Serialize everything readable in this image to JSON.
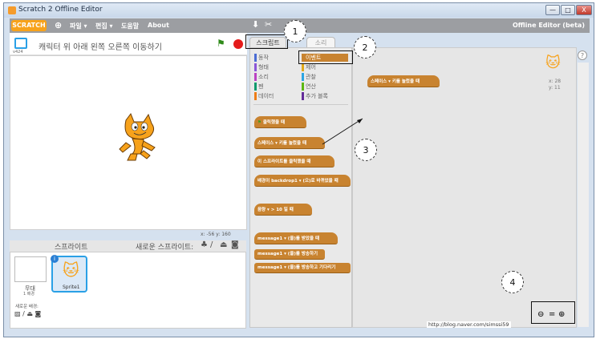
{
  "window": {
    "title": "Scratch 2 Offline Editor",
    "min": "—",
    "max": "□",
    "close": "X"
  },
  "menubar": {
    "logo": "SCRATCH",
    "items": [
      "파일 ▾",
      "편집 ▾",
      "도움말",
      "About"
    ],
    "editor_title": "Offline Editor (beta)"
  },
  "stage": {
    "project_title": "캐릭터 위 아래 왼쪽 오른쪽 이동하기",
    "version": "v424",
    "coords": "x: -56  y: 160"
  },
  "tabs": {
    "scripts": "스크립트",
    "sounds": "소리"
  },
  "palette": {
    "categories_left": [
      "동작",
      "형태",
      "소리",
      "펜",
      "데이터"
    ],
    "categories_right": [
      "이벤트",
      "제어",
      "관찰",
      "연산",
      "추가 블록"
    ],
    "blocks": {
      "when_flag": "클릭했을 때",
      "when_key": "스페이스 ▾  키를 눌렀을 때",
      "when_sprite_clicked": "이 스프라이트를 클릭했을 때",
      "when_backdrop": "배경이 backdrop1 ▾ (으)로 바뀌었을 때",
      "when_loudness": "음량 ▾ >  10  일 때",
      "when_receive": "message1 ▾ (을)를 받았을 때",
      "broadcast": "message1 ▾ (을)를 방송하기",
      "broadcast_wait": "message1 ▾ (을)를 방송하고 기다리기"
    }
  },
  "scripts": {
    "placed_block": "스페이스 ▾  키를 눌렀을 때",
    "sprite_x": "x: 28",
    "sprite_y": "y: 11",
    "watermark": "http://blog.naver.com/simssi59"
  },
  "sprites": {
    "header_label": "스프라이트",
    "new_sprite_label": "새로운 스프라이트:",
    "stage_label": "무대",
    "stage_backdrops": "1 배경",
    "new_backdrop_label": "새로운 배경:",
    "sprite1_name": "Sprite1"
  },
  "callouts": [
    "1",
    "2",
    "3",
    "4"
  ],
  "colors": {
    "accent": "#f7a21b",
    "event_block": "#c88330",
    "motion": "#4a6cd4",
    "looks": "#8a55d7",
    "sound": "#bb42c3",
    "pen": "#0e9a6c",
    "data": "#ee7d16",
    "control": "#e1a91a",
    "sensing": "#2ca5e2",
    "operators": "#5cb712",
    "more": "#632d99"
  }
}
